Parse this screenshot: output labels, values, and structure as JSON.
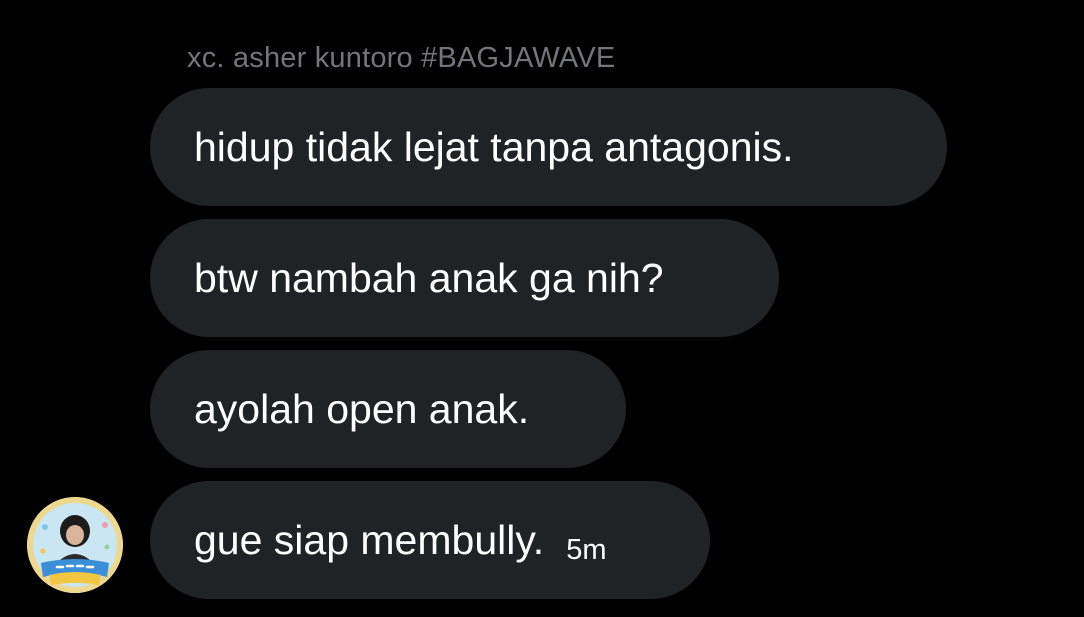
{
  "conversation": {
    "sender_name": "xc. asher kuntoro #BAGJAWAVE",
    "messages": [
      {
        "text": "hidup tidak lejat tanpa antagonis."
      },
      {
        "text": "btw nambah anak ga nih?"
      },
      {
        "text": "ayolah open anak."
      },
      {
        "text": "gue siap membully.",
        "timestamp": "5m"
      }
    ],
    "avatar": {
      "label": "BAGJA WAVE",
      "icon": "user-avatar"
    }
  },
  "colors": {
    "background": "#000000",
    "bubble": "#1f2326",
    "text": "#ffffff",
    "muted": "#71767b"
  }
}
